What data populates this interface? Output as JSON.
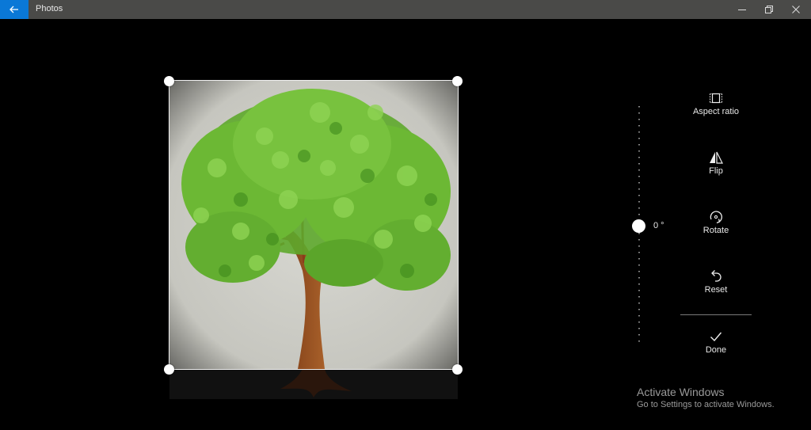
{
  "window": {
    "title": "Photos",
    "back_icon": "arrow-left-icon",
    "controls": {
      "minimize_icon": "minimize-icon",
      "restore_icon": "restore-icon",
      "close_icon": "close-icon"
    }
  },
  "editor": {
    "image_subject": "tree-illustration",
    "straighten": {
      "angle_label": "0 °",
      "angle_value": 0
    },
    "tools": [
      {
        "label": "Aspect ratio",
        "icon": "aspect-ratio-icon"
      },
      {
        "label": "Flip",
        "icon": "flip-icon"
      },
      {
        "label": "Rotate",
        "icon": "rotate-icon"
      },
      {
        "label": "Reset",
        "icon": "reset-icon"
      },
      {
        "label": "Done",
        "icon": "checkmark-icon"
      }
    ]
  },
  "watermark": {
    "title": "Activate Windows",
    "subtitle": "Go to Settings to activate Windows."
  },
  "colors": {
    "accent": "#0a78d7",
    "titlebar": "#4a4a48",
    "background": "#000000"
  }
}
